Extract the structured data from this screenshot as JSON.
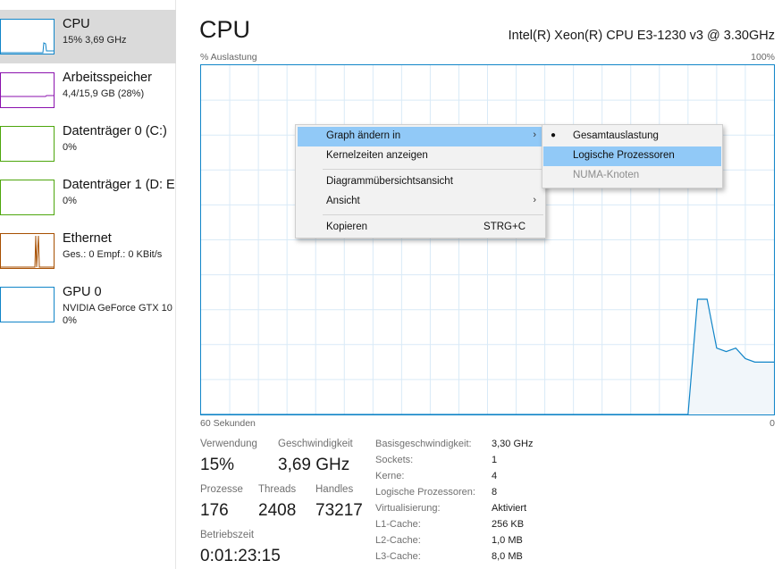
{
  "sidebar": {
    "items": [
      {
        "title": "CPU",
        "sub": "15% 3,69 GHz",
        "sub2": "",
        "color": "#1185c8"
      },
      {
        "title": "Arbeitsspeicher",
        "sub": "4,4/15,9 GB (28%)",
        "sub2": "",
        "color": "#8b12ae"
      },
      {
        "title": "Datenträger 0 (C:)",
        "sub": "0%",
        "sub2": "",
        "color": "#4da60c"
      },
      {
        "title": "Datenträger 1 (D: E",
        "sub": "0%",
        "sub2": "",
        "color": "#4da60c"
      },
      {
        "title": "Ethernet",
        "sub": "Ges.: 0 Empf.: 0 KBit/s",
        "sub2": "",
        "color": "#a74f01"
      },
      {
        "title": "GPU 0",
        "sub": "NVIDIA GeForce GTX 10",
        "sub2": "0%",
        "color": "#1185c8"
      }
    ]
  },
  "main": {
    "title": "CPU",
    "cpu_model": "Intel(R) Xeon(R) CPU E3-1230 v3 @ 3.30GHz",
    "axis_top_left": "% Auslastung",
    "axis_top_right": "100%",
    "axis_bottom_left": "60 Sekunden",
    "axis_bottom_right": "0"
  },
  "chart_data": {
    "type": "area",
    "ylabel": "% Auslastung",
    "xlabel": "60 Sekunden",
    "ylim": [
      0,
      100
    ],
    "xlim": [
      60,
      0
    ],
    "x": [
      60,
      9,
      8,
      7,
      6,
      5,
      4,
      3,
      2,
      1,
      0
    ],
    "values": [
      0,
      0,
      33,
      33,
      19,
      18,
      19,
      16,
      15,
      15,
      15
    ],
    "color": "#1185c8",
    "grid": true
  },
  "stats": {
    "verwendung_label": "Verwendung",
    "verwendung_value": "15%",
    "geschwindigkeit_label": "Geschwindigkeit",
    "geschwindigkeit_value": "3,69 GHz",
    "prozesse_label": "Prozesse",
    "prozesse_value": "176",
    "threads_label": "Threads",
    "threads_value": "2408",
    "handles_label": "Handles",
    "handles_value": "73217",
    "betriebszeit_label": "Betriebszeit",
    "betriebszeit_value": "0:01:23:15"
  },
  "specs": [
    {
      "label": "Basisgeschwindigkeit:",
      "value": "3,30 GHz"
    },
    {
      "label": "Sockets:",
      "value": "1"
    },
    {
      "label": "Kerne:",
      "value": "4"
    },
    {
      "label": "Logische Prozessoren:",
      "value": "8"
    },
    {
      "label": "Virtualisierung:",
      "value": "Aktiviert"
    },
    {
      "label": "L1-Cache:",
      "value": "256 KB"
    },
    {
      "label": "L2-Cache:",
      "value": "1,0 MB"
    },
    {
      "label": "L3-Cache:",
      "value": "8,0 MB"
    }
  ],
  "context_menu": {
    "items": [
      {
        "label": "Graph ändern in",
        "has_submenu": true,
        "highlighted": true
      },
      {
        "label": "Kernelzeiten anzeigen"
      },
      {
        "label": "Diagrammübersichtsansicht"
      },
      {
        "label": "Ansicht",
        "has_submenu": true
      },
      {
        "label": "Kopieren",
        "accelerator": "STRG+C"
      }
    ],
    "arrow_glyph": "›"
  },
  "submenu": {
    "items": [
      {
        "label": "Gesamtauslastung",
        "checked": true,
        "bullet": "●"
      },
      {
        "label": "Logische Prozessoren",
        "highlighted": true
      },
      {
        "label": "NUMA-Knoten",
        "disabled": true
      }
    ]
  }
}
